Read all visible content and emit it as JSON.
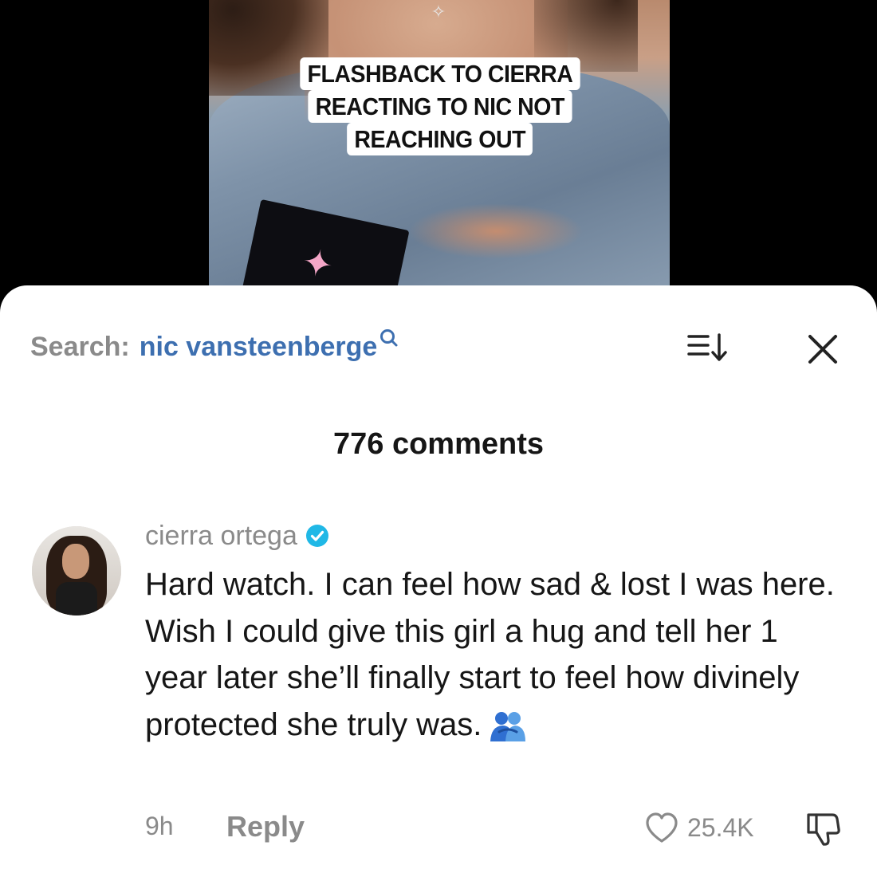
{
  "video": {
    "caption_lines": [
      "FLASHBACK TO CIERRA",
      "REACTING TO NIC NOT",
      "REACHING OUT"
    ]
  },
  "search": {
    "prefix": "Search:",
    "term": "nic vansteenberge",
    "icon": "search-icon"
  },
  "header": {
    "sort_icon": "sort-icon",
    "close_icon": "close-icon",
    "comment_count": "776 comments"
  },
  "comment": {
    "username": "cierra ortega",
    "verified": true,
    "text": "Hard watch. I can feel how sad & lost I was here. Wish I could give this girl a hug and tell her 1 year later she’ll finally start to feel how divinely protected she truly was.",
    "emoji": "people-hugging-emoji",
    "time": "9h",
    "reply_label": "Reply",
    "like_count": "25.4K"
  },
  "colors": {
    "link_blue": "#3d6fb0",
    "verified_blue": "#20b8e6",
    "muted_gray": "#8a8a8a",
    "text": "#161616"
  }
}
